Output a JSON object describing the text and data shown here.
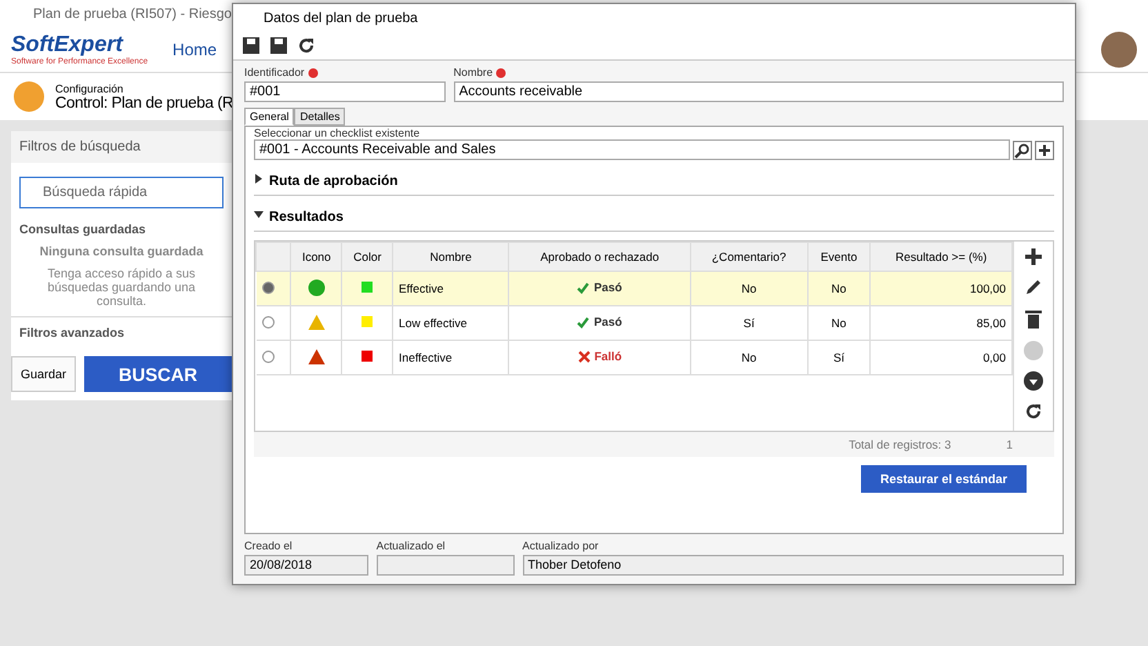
{
  "background_app": {
    "window_title": "Plan de prueba (RI507) - Riesgo",
    "logo": "SoftExpert",
    "logo_tagline": "Software for Performance Excellence",
    "nav_home": "Home",
    "breadcrumb": "Configuración",
    "page_title": "Control: Plan de prueba (R",
    "filters_title": "Filtros de búsqueda",
    "search_placeholder": "Búsqueda rápida",
    "saved_queries": "Consultas guardadas",
    "no_saved": "Ninguna consulta guardada",
    "saved_hint": "Tenga acceso rápido a sus búsquedas guardando una consulta.",
    "advanced_filters": "Filtros avanzados",
    "save_button": "Guardar",
    "search_button": "BUSCAR"
  },
  "dialog": {
    "title": "Datos del plan de prueba",
    "fields": [
      {
        "label": "Identificador",
        "required": true,
        "value": "#001"
      },
      {
        "label": "Nombre",
        "required": true,
        "value": "Accounts receivable"
      }
    ],
    "tabs": [
      {
        "label": "General",
        "selected": true
      },
      {
        "label": "Detalles",
        "selected": false
      }
    ],
    "checklist": {
      "label": "Seleccionar un checklist existente",
      "value": "#001 - Accounts Receivable and Sales"
    },
    "sections": [
      {
        "title": "Ruta de aprobación",
        "expanded": false
      },
      {
        "title": "Resultados",
        "expanded": true
      }
    ],
    "table": {
      "columns": [
        "Icono",
        "Color",
        "Nombre",
        "Aprobado o rechazado",
        "¿Comentario?",
        "Evento",
        "Resultado >= (%)"
      ],
      "rows": [
        {
          "selected": true,
          "icon": {
            "kind": "circle",
            "color": "#22aa22"
          },
          "swatch": {
            "color": "#22dd22"
          },
          "name": "Effective",
          "passed": true,
          "result": "Pasó",
          "comment": "No",
          "event": "No",
          "threshold": "100,00"
        },
        {
          "selected": false,
          "icon": {
            "kind": "triangle",
            "color": "#e8b400"
          },
          "swatch": {
            "color": "#ffee00"
          },
          "name": "Low effective",
          "passed": true,
          "result": "Pasó",
          "comment": "Sí",
          "event": "No",
          "threshold": "85,00"
        },
        {
          "selected": false,
          "icon": {
            "kind": "triangle",
            "color": "#cc3300"
          },
          "swatch": {
            "color": "#ee0000"
          },
          "name": "Ineffective",
          "passed": false,
          "result": "Falló",
          "comment": "No",
          "event": "Sí",
          "threshold": "0,00"
        }
      ],
      "total": "Total de registros: 3",
      "page": "1"
    },
    "restore_button": "Restaurar el estándar",
    "footer": [
      {
        "label": "Creado el",
        "value": "20/08/2018"
      },
      {
        "label": "Actualizado el"
      },
      {
        "label": "Actualizado por",
        "value": "Thober Detofeno"
      }
    ]
  }
}
